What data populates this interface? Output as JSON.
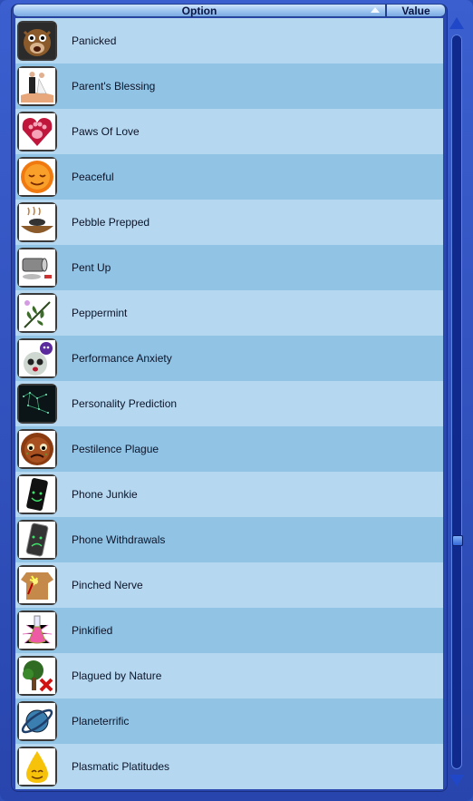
{
  "header": {
    "option_label": "Option",
    "value_label": "Value",
    "sort_direction": "ascending"
  },
  "rows": [
    {
      "label": "Panicked",
      "icon": "panicked-face-icon"
    },
    {
      "label": "Parent's Blessing",
      "icon": "couple-in-hand-icon"
    },
    {
      "label": "Paws Of Love",
      "icon": "paw-heart-icon"
    },
    {
      "label": "Peaceful",
      "icon": "peaceful-face-icon"
    },
    {
      "label": "Pebble Prepped",
      "icon": "pebble-pot-icon"
    },
    {
      "label": "Pent Up",
      "icon": "spilled-can-icon"
    },
    {
      "label": "Peppermint",
      "icon": "peppermint-leaf-icon"
    },
    {
      "label": "Performance Anxiety",
      "icon": "anxious-face-icon"
    },
    {
      "label": "Personality Prediction",
      "icon": "constellation-icon"
    },
    {
      "label": "Pestilence Plague",
      "icon": "sick-face-icon"
    },
    {
      "label": "Phone Junkie",
      "icon": "happy-phone-icon"
    },
    {
      "label": "Phone Withdrawals",
      "icon": "sad-phone-icon"
    },
    {
      "label": "Pinched Nerve",
      "icon": "pinched-nerve-icon"
    },
    {
      "label": "Pinkified",
      "icon": "pink-potion-icon"
    },
    {
      "label": "Plagued by Nature",
      "icon": "tree-cross-icon"
    },
    {
      "label": "Planeterrific",
      "icon": "planet-icon"
    },
    {
      "label": "Plasmatic Platitudes",
      "icon": "plasma-drop-icon"
    }
  ],
  "colors": {
    "row_light": "#b5d7f0",
    "row_dark": "#91c3e5",
    "frame": "#2f4fb8",
    "scroll_arrow": "#1f47c7"
  },
  "scrollbar": {
    "position_fraction": 0.68
  }
}
